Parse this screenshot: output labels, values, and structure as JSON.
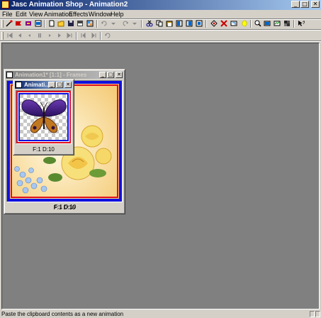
{
  "app": {
    "title": "Jasc Animation Shop - Animation2",
    "title_buttons": [
      "_",
      "□",
      "✕"
    ]
  },
  "menu": [
    "File",
    "Edit",
    "View",
    "Animation",
    "Effects",
    "Window",
    "Help"
  ],
  "toolbar1": {
    "icons": [
      "wizard-icon",
      "banner-icon",
      "effect-icon",
      "video-icon",
      "new-icon",
      "open-icon",
      "save-icon",
      "save-as-icon",
      "browse-icon",
      "undo-icon",
      "undo-dropdown-icon",
      "redo-icon",
      "redo-dropdown-icon",
      "cut-icon",
      "copy-icon",
      "paste-new-icon",
      "paste-before-icon",
      "paste-after-icon",
      "paste-into-icon",
      "replace-color-icon",
      "delete-icon",
      "crop-icon",
      "frame-properties-icon",
      "zoom-icon",
      "view-animation-icon",
      "optimize-icon",
      "palette-icon",
      "help-icon"
    ]
  },
  "toolbar2": {
    "icons": [
      "first-frame-icon",
      "prev-frame-icon",
      "play-back-icon",
      "stop-icon",
      "play-icon",
      "next-frame-icon",
      "last-frame-icon",
      "step-back-icon",
      "step-forward-icon",
      "loop-icon"
    ]
  },
  "windows": {
    "frames": {
      "title": "Animation1* [1:1] - Frames",
      "frame_label": "F:1   D:10"
    },
    "animation2": {
      "title": "Animati...",
      "frame_label": "F:1   D:10"
    }
  },
  "status": {
    "text": "Paste the clipboard contents as a new animation"
  },
  "colors": {
    "title_active": "#0a246a",
    "workspace": "#808080",
    "frame_border_blue": "#1010e0",
    "frame_border_red": "#e01020",
    "flower_bg": "#f7d98a"
  }
}
